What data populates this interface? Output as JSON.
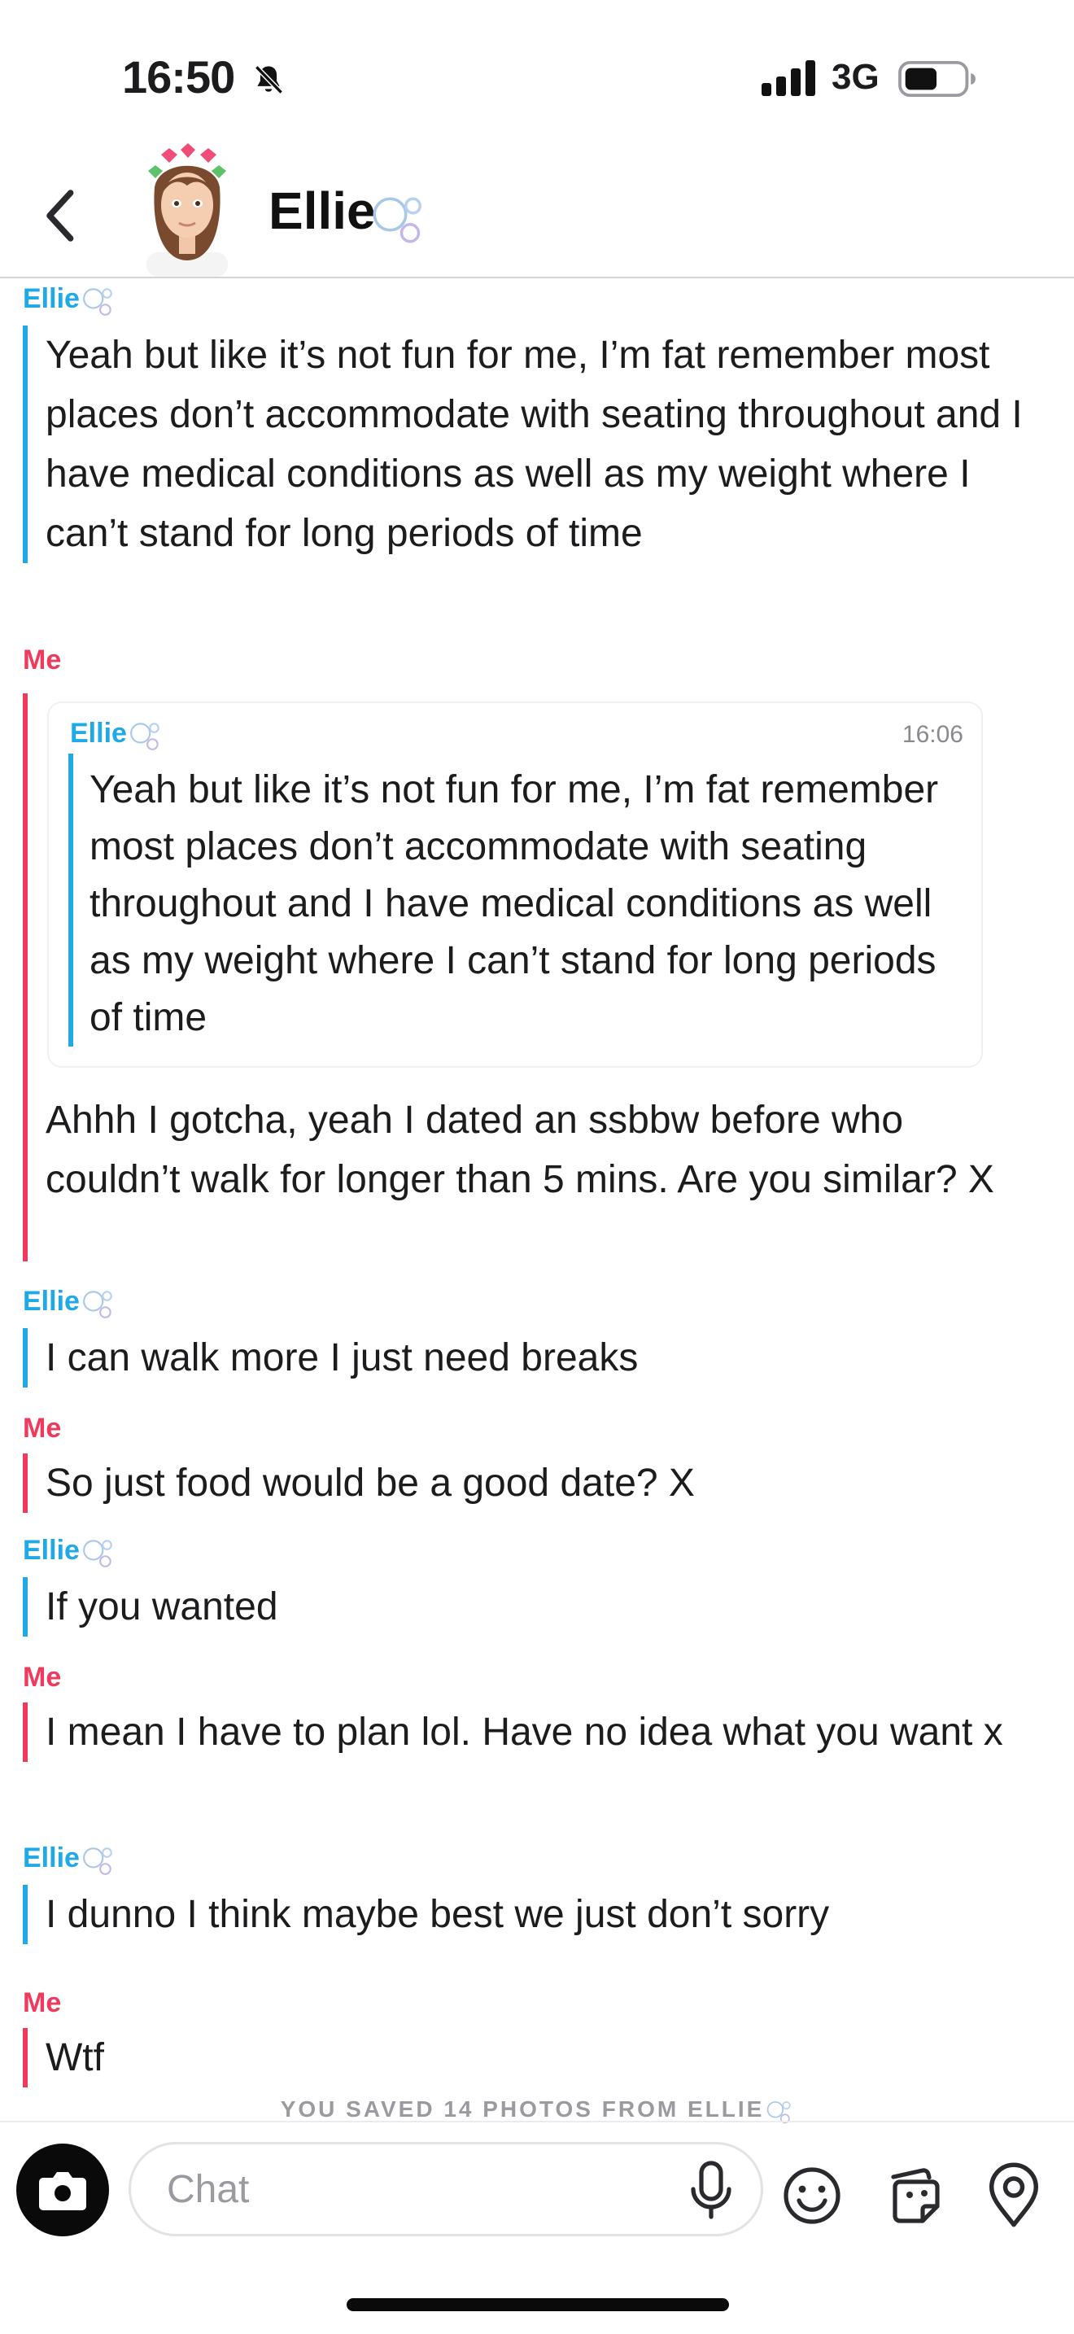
{
  "status_bar": {
    "time": "16:50",
    "network": "3G"
  },
  "header": {
    "contact_name": "Ellie"
  },
  "messages": [
    {
      "sender": "Ellie",
      "text": "Yeah but like it’s not fun for me, I’m fat remember most places don’t accommodate with seating throughout and I have medical conditions as well as my weight where I can’t stand for long periods of time"
    },
    {
      "sender": "Me",
      "quote": {
        "sender": "Ellie",
        "time": "16:06",
        "text": "Yeah but like it’s not fun for me, I’m fat remember most places don’t accommodate with seating throughout and I have medical conditions as well as my weight where I can’t stand for long periods of time"
      },
      "text": "Ahhh I gotcha, yeah I dated an ssbbw before who couldn’t walk for longer than 5 mins. Are you similar? X"
    },
    {
      "sender": "Ellie",
      "text": "I can walk more I just need breaks"
    },
    {
      "sender": "Me",
      "text": "So just food would be a good date? X"
    },
    {
      "sender": "Ellie",
      "text": "If you wanted"
    },
    {
      "sender": "Me",
      "text": "I mean I have to plan lol. Have no idea what you want x"
    },
    {
      "sender": "Ellie",
      "text": "I dunno I think maybe best we just don’t sorry"
    },
    {
      "sender": "Me",
      "text": "Wtf"
    }
  ],
  "system_notice": "YOU SAVED 14 PHOTOS FROM ELLIE",
  "composer": {
    "placeholder": "Chat"
  },
  "colors": {
    "friend": "#1fa9e6",
    "me": "#ef3a5d"
  },
  "icons": [
    "bell-slash-icon",
    "signal-icon",
    "battery-icon",
    "back-chevron-icon",
    "bitmoji-avatar",
    "bubbles-icon",
    "camera-icon",
    "microphone-icon",
    "emoji-icon",
    "sticker-icon",
    "location-pin-icon"
  ]
}
